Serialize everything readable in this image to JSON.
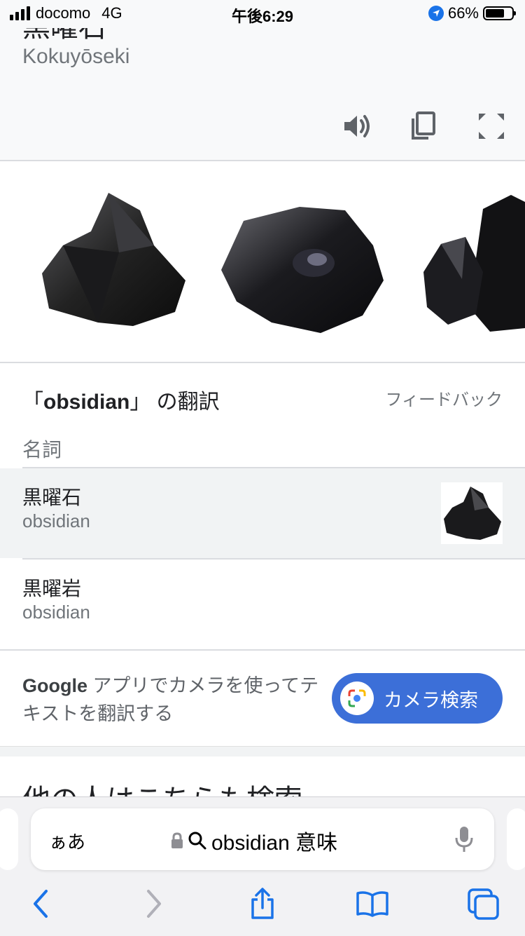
{
  "status": {
    "carrier": "docomo",
    "network": "4G",
    "time": "午後6:29",
    "battery": "66%",
    "battery_level": 0.66
  },
  "top": {
    "word": "黒曜石",
    "romaji": "Kokuyōseki"
  },
  "toolbar": {
    "icons": [
      "speaker-icon",
      "copy-icon",
      "fullscreen-icon"
    ]
  },
  "translations": {
    "title_prefix": "「",
    "term": "obsidian",
    "title_suffix": "」 の翻訳",
    "feedback": "フィードバック",
    "part_of_speech": "名詞",
    "items": [
      {
        "term": "黒曜石",
        "gloss": "obsidian"
      },
      {
        "term": "黒曜岩",
        "gloss": "obsidian"
      }
    ]
  },
  "promo": {
    "brand": "Google",
    "text": " アプリでカメラを使ってテキストを翻訳する",
    "button": "カメラ検索"
  },
  "others": {
    "heading": "他の人はこちらも検索"
  },
  "browser": {
    "aa": "ぁあ",
    "query": "obsidian 意味"
  },
  "colors": {
    "accent": "#1a73e8",
    "button": "#3c6fd8",
    "card_bg": "#f8f9fa"
  }
}
